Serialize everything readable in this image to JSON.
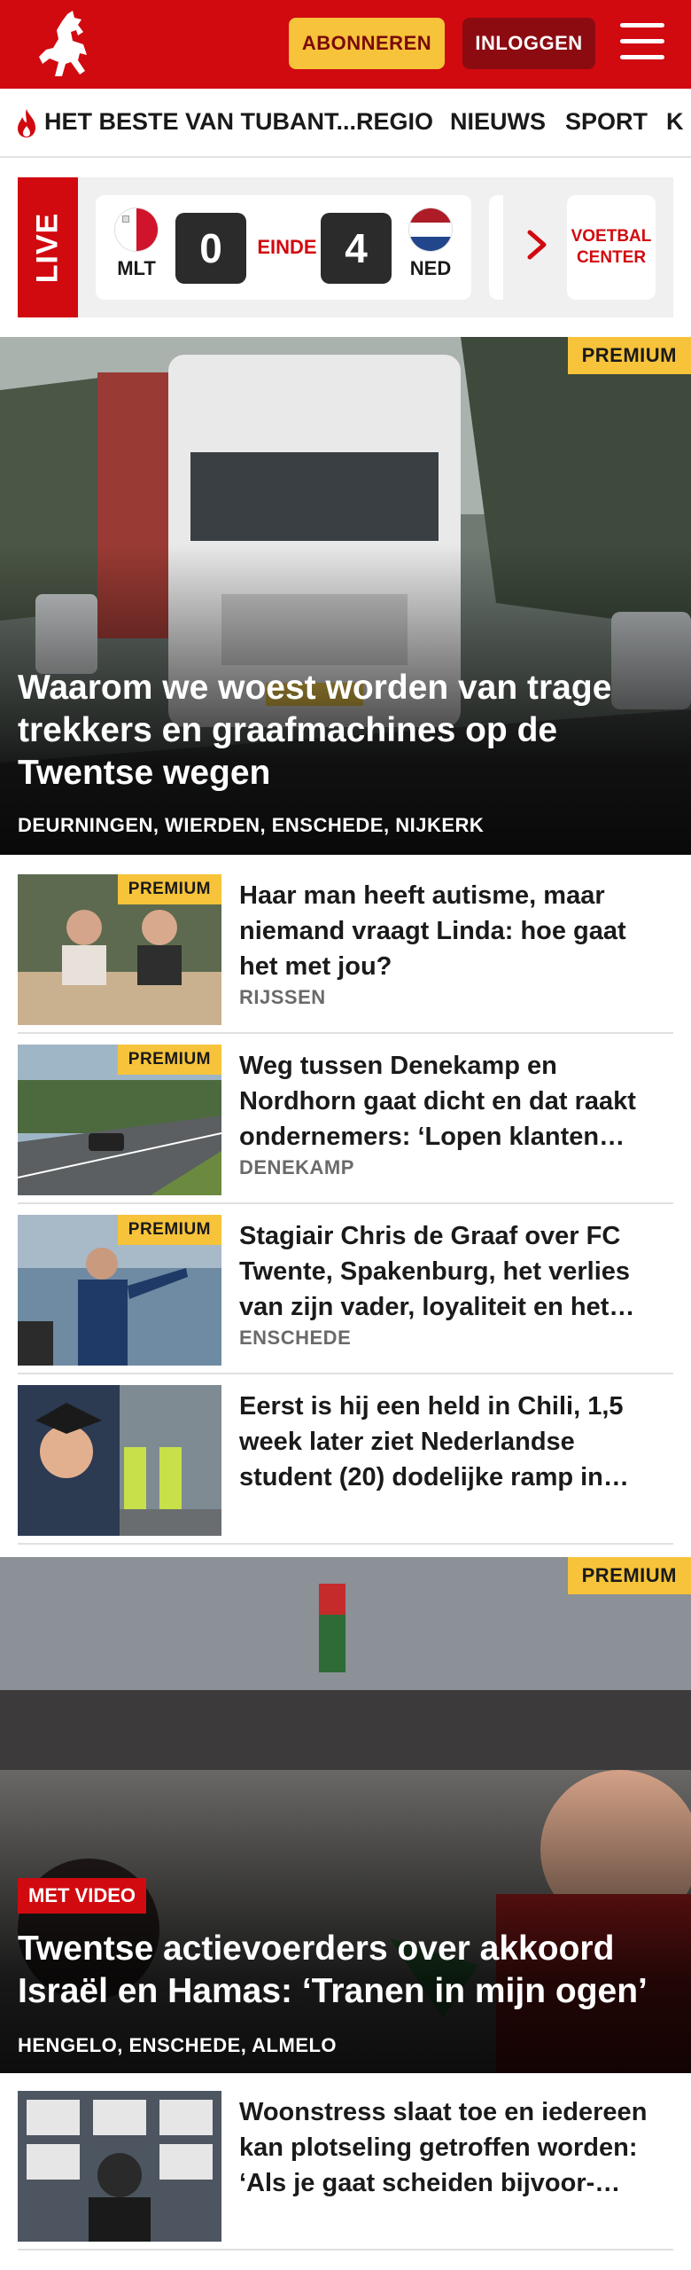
{
  "header": {
    "subscribe_label": "ABONNEREN",
    "login_label": "INLOGGEN",
    "brand_color": "#d10a10"
  },
  "nav": {
    "items": [
      "HET BESTE VAN TUBANT...",
      "REGIO",
      "NIEUWS",
      "SPORT",
      "K"
    ]
  },
  "live": {
    "label": "LIVE",
    "home": {
      "code": "MLT",
      "score": "0"
    },
    "away": {
      "code": "NED",
      "score": "4"
    },
    "status": "EINDE",
    "center_label": "VOETBAL CENTER"
  },
  "hero1": {
    "badge": "PREMIUM",
    "title": "Waarom we woest worden van trage trekkers en graafmachines op de Twentse wegen",
    "locations": "DEURNINGEN, WIERDEN, ENSCHEDE, NIJKERK"
  },
  "articles": [
    {
      "badge": "PREMIUM",
      "title": "Haar man heeft autisme, maar niemand vraagt Linda: hoe gaat het met jou?",
      "location": "RIJSSEN"
    },
    {
      "badge": "PREMIUM",
      "title": "Weg tussen Denekamp en Nordhorn gaat dicht en dat raakt ondernemers: ‘Lopen klanten…",
      "location": "DENEKAMP"
    },
    {
      "badge": "PREMIUM",
      "title": "Stagiair Chris de Graaf over FC Twente, Spakenburg, het verlies van zijn vader, loyaliteit en het…",
      "location": "ENSCHEDE"
    },
    {
      "badge": "",
      "title": "Eerst is hij een held in Chili, 1,5 week later ziet Nederlandse student (20) dodelijke ramp in…",
      "location": ""
    }
  ],
  "hero2": {
    "badge": "PREMIUM",
    "video_badge": "MET VIDEO",
    "title": "Twentse actievoerders over akkoord Israël en Hamas: ‘Tranen in mijn ogen’",
    "locations": "HENGELO, ENSCHEDE, ALMELO"
  },
  "articles2": [
    {
      "title": "Woonstress slaat toe en iedereen kan plotseling getroffen worden: ‘Als je gaat scheiden bijvoor-…"
    }
  ]
}
